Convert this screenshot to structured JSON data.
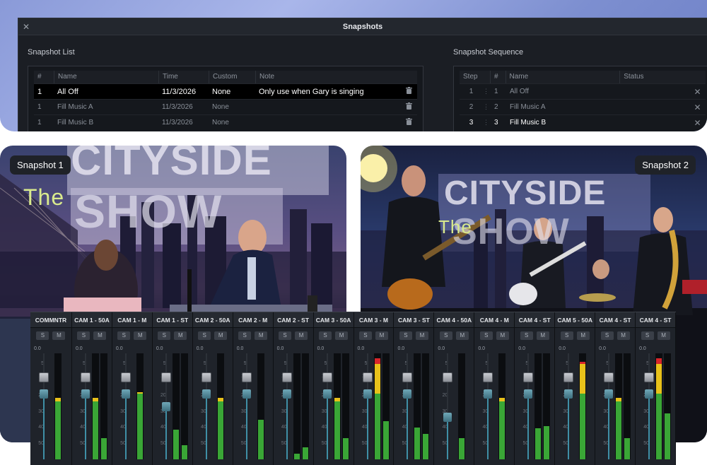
{
  "window": {
    "title": "Snapshots",
    "close_glyph": "✕",
    "list_title": "Snapshot List",
    "sequence_title": "Snapshot Sequence"
  },
  "snapshot_list": {
    "columns": [
      "#",
      "Name",
      "Time",
      "Custom",
      "Note"
    ],
    "rows": [
      {
        "num": "1",
        "name": "All Off",
        "time": "11/3/2026",
        "custom": "None",
        "note": "Only use when Gary is singing",
        "icon": "trash-icon",
        "selected": true
      },
      {
        "num": "1",
        "name": "Fill Music A",
        "time": "11/3/2026",
        "custom": "None",
        "note": "",
        "icon": "trash-icon",
        "selected": false
      },
      {
        "num": "1",
        "name": "Fill Music B",
        "time": "11/3/2026",
        "custom": "None",
        "note": "",
        "icon": "trash-icon",
        "selected": false
      }
    ]
  },
  "snapshot_sequence": {
    "columns": [
      "Step",
      "#",
      "Name",
      "Status"
    ],
    "rows": [
      {
        "step": "1",
        "num": "1",
        "name": "All Off",
        "icon": "close-icon",
        "active": false
      },
      {
        "step": "2",
        "num": "2",
        "name": "Fill Music A",
        "icon": "close-icon",
        "active": false
      },
      {
        "step": "3",
        "num": "3",
        "name": "Fill Music B",
        "icon": "close-icon",
        "active": true
      }
    ]
  },
  "shots": [
    {
      "label": "Snapshot 1"
    },
    {
      "label": "Snapshot 2"
    }
  ],
  "mixer": {
    "solo_label": "S",
    "mute_label": "M",
    "zero_label": "0.0",
    "scale": [
      "5",
      "10",
      "20",
      "30",
      "40",
      "50"
    ],
    "channels": [
      {
        "name": "COMMNTR",
        "fader": 0.62,
        "meter": [
          0.58
        ]
      },
      {
        "name": "CAM 1 - 50A",
        "fader": 0.62,
        "meter": [
          0.58,
          0.2
        ]
      },
      {
        "name": "CAM 1 - M",
        "fader": 0.62,
        "meter": [
          0.63
        ]
      },
      {
        "name": "CAM 1 - ST",
        "fader": 0.5,
        "meter": [
          0.28,
          0.13
        ]
      },
      {
        "name": "CAM 2 - 50A",
        "fader": 0.62,
        "meter": [
          0.58
        ]
      },
      {
        "name": "CAM 2 - M",
        "fader": 0.62,
        "meter": [
          0.37
        ]
      },
      {
        "name": "CAM 2 - ST",
        "fader": 0.62,
        "meter": [
          0.05,
          0.11
        ]
      },
      {
        "name": "CAM 3 - 50A",
        "fader": 0.62,
        "meter": [
          0.58,
          0.2
        ]
      },
      {
        "name": "CAM 3 - M",
        "fader": 0.62,
        "meter": [
          0.95,
          0.36
        ]
      },
      {
        "name": "CAM 3 - ST",
        "fader": 0.62,
        "meter": [
          0.3,
          0.24
        ]
      },
      {
        "name": "CAM 4 - 50A",
        "fader": 0.4,
        "meter": [
          0.2
        ]
      },
      {
        "name": "CAM 4 - M",
        "fader": 0.62,
        "meter": [
          0.58
        ]
      },
      {
        "name": "CAM 4 - ST",
        "fader": 0.62,
        "meter": [
          0.29,
          0.31
        ]
      },
      {
        "name": "CAM 5 - 50A",
        "fader": 0.62,
        "meter": [
          0.92
        ]
      },
      {
        "name": "CAM 4 - ST",
        "fader": 0.62,
        "meter": [
          0.58,
          0.2
        ]
      },
      {
        "name": "CAM 4 - ST",
        "fader": 0.62,
        "meter": [
          0.95,
          0.43
        ]
      }
    ],
    "colors": {
      "green": "#3aa636",
      "yellow": "#e8c11a",
      "red": "#d8262b",
      "fader_blue": "#3f8fa6"
    }
  }
}
